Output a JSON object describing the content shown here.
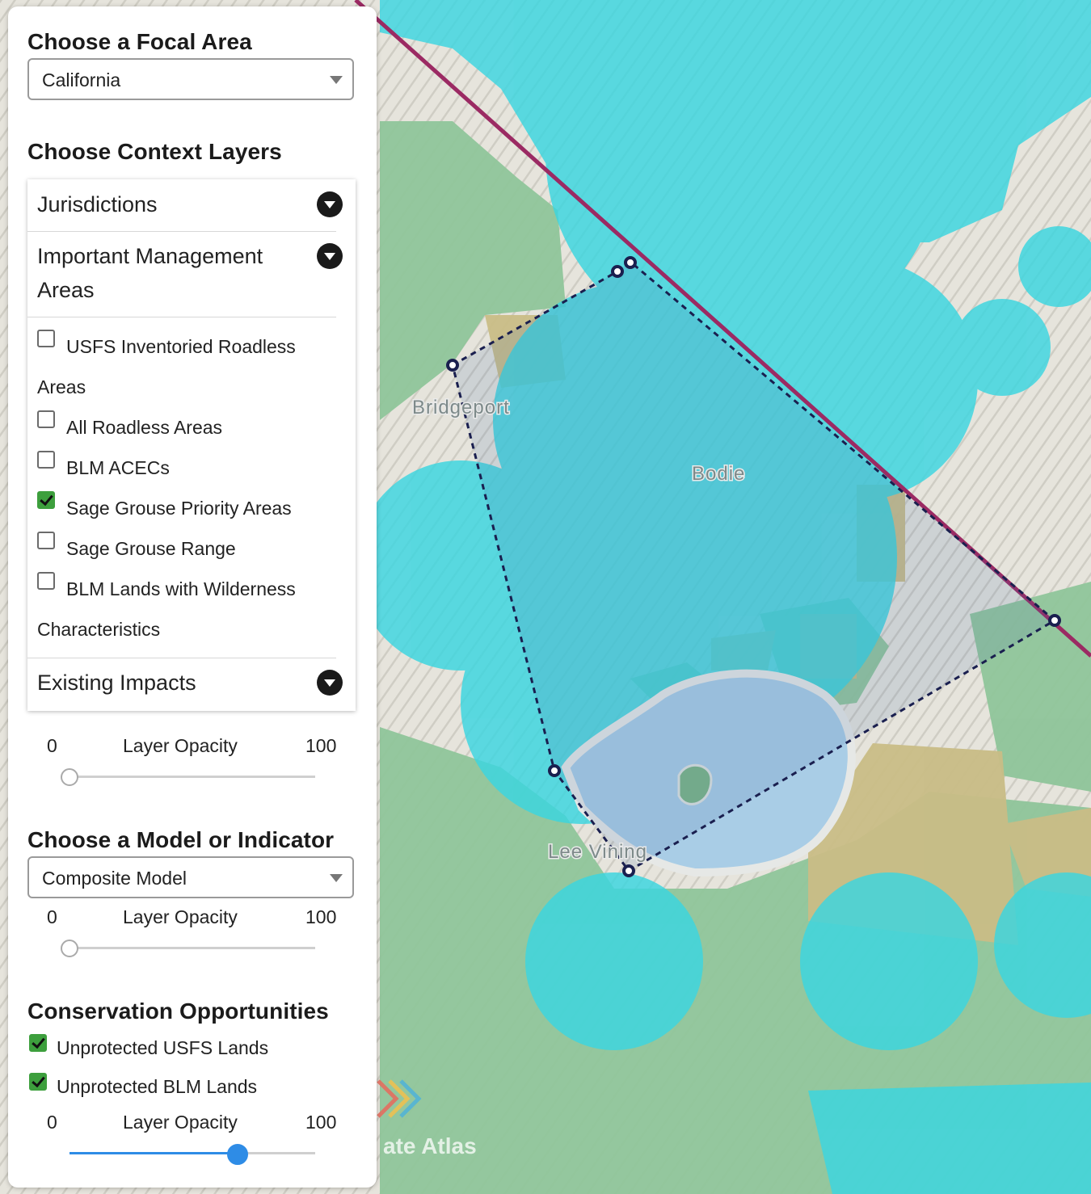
{
  "focal_area": {
    "heading": "Choose a Focal Area",
    "selected": "California"
  },
  "context_layers": {
    "heading": "Choose Context Layers",
    "sections": [
      {
        "label": "Jurisdictions"
      },
      {
        "label": "Important Management Areas"
      },
      {
        "label": "Existing Impacts"
      }
    ],
    "options": [
      {
        "label": "USFS Inventoried Roadless Areas",
        "checked": false
      },
      {
        "label": "All Roadless Areas",
        "checked": false
      },
      {
        "label": "BLM ACECs",
        "checked": false
      },
      {
        "label": "Sage Grouse Priority Areas",
        "checked": true
      },
      {
        "label": "Sage Grouse Range",
        "checked": false
      },
      {
        "label": "BLM Lands with Wilderness Characteristics",
        "checked": false
      }
    ],
    "opacity": {
      "min": "0",
      "label": "Layer Opacity",
      "max": "100",
      "value": 0
    }
  },
  "model": {
    "heading": "Choose a Model or Indicator",
    "selected": "Composite Model",
    "opacity": {
      "min": "0",
      "label": "Layer Opacity",
      "max": "100",
      "value": 0
    }
  },
  "conservation": {
    "heading": "Conservation Opportunities",
    "options": [
      {
        "label": "Unprotected USFS Lands",
        "checked": true
      },
      {
        "label": "Unprotected BLM Lands",
        "checked": true
      }
    ],
    "opacity": {
      "min": "0",
      "label": "Layer Opacity",
      "max": "100",
      "value": 68
    }
  },
  "map": {
    "places": [
      "Bridgeport",
      "Bodie",
      "Lee Vining"
    ],
    "watermark": "ate Atlas",
    "colors": {
      "terrain": "#e9e7df",
      "usfs_green": "#8fc59a",
      "blm_tan": "#c9bd86",
      "sage_grouse_cyan": "#3ad6e0",
      "lake": "#a9cde6",
      "state_line": "#9b2a63",
      "polygon_stroke": "#1a1f4f"
    }
  }
}
